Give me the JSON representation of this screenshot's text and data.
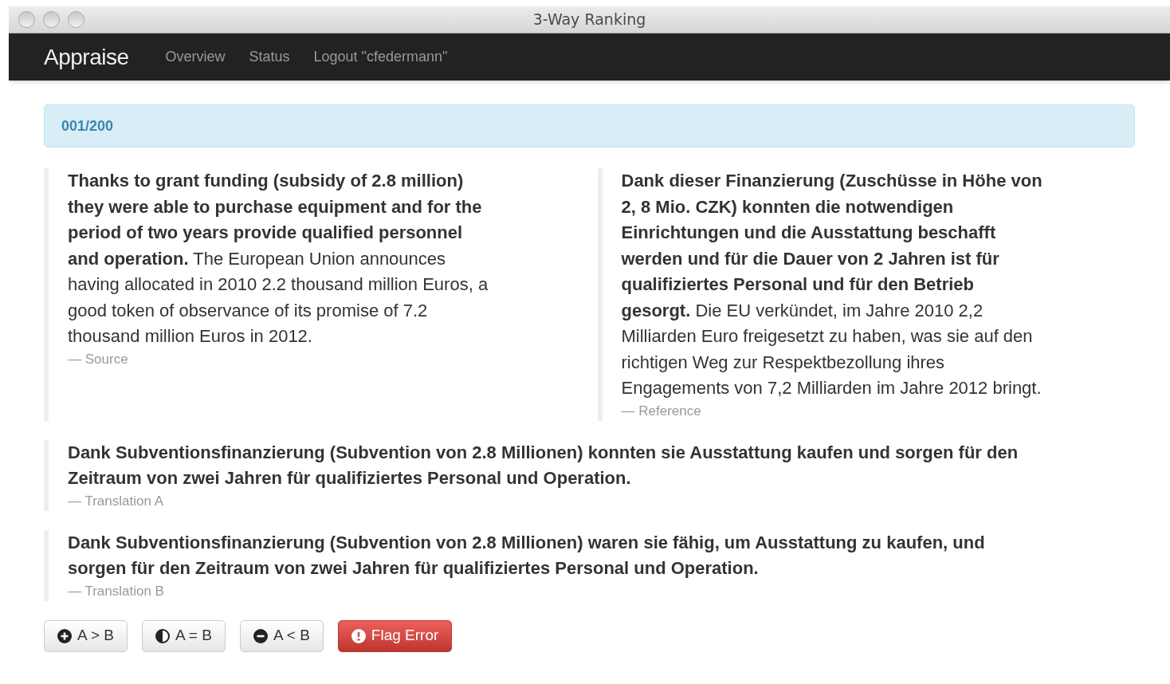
{
  "window": {
    "title": "3-Way Ranking"
  },
  "navbar": {
    "brand": "Appraise",
    "links": [
      "Overview",
      "Status",
      "Logout \"cfedermann\""
    ]
  },
  "progress": "001/200",
  "source": {
    "text": "**Thanks to grant funding (subsidy of 2.8 million) they were able to purchase equipment and for the period of two years provide qualified personnel and operation.** The European Union announces having allocated in 2010 2.2 thousand million Euros, a good token of observance of its promise of 7.2 thousand million Euros in 2012.",
    "label": "— Source"
  },
  "reference": {
    "text": "**Dank dieser Finanzierung (Zuschüsse in Höhe von 2, 8 Mio. CZK) konnten die notwendigen Einrichtungen und die Ausstattung beschafft werden und für die Dauer von 2 Jahren ist für qualifiziertes Personal und für den Betrieb gesorgt.** Die EU verkündet, im Jahre 2010 2,2 Milliarden Euro freigesetzt zu haben, was sie auf den richtigen Weg zur Respektbezollung ihres Engagements von 7,2 Milliarden im Jahre 2012 bringt.",
    "label": "— Reference"
  },
  "translations": [
    {
      "text": "Dank Subventionsfinanzierung (Subvention von 2.8 Millionen) konnten sie Ausstattung kaufen und sorgen für den Zeitraum von zwei Jahren für qualifiziertes Personal und Operation.",
      "label": "— Translation A"
    },
    {
      "text": "Dank Subventionsfinanzierung (Subvention von 2.8 Millionen) waren sie fähig, um Ausstattung zu kaufen, und sorgen für den Zeitraum von zwei Jahren für qualifiziertes Personal und Operation.",
      "label": "— Translation B"
    }
  ],
  "buttons": [
    {
      "kind": "better",
      "label": "A > B"
    },
    {
      "kind": "equal",
      "label": "A = B"
    },
    {
      "kind": "worse",
      "label": "A < B"
    },
    {
      "kind": "flag",
      "label": "Flag Error"
    }
  ]
}
